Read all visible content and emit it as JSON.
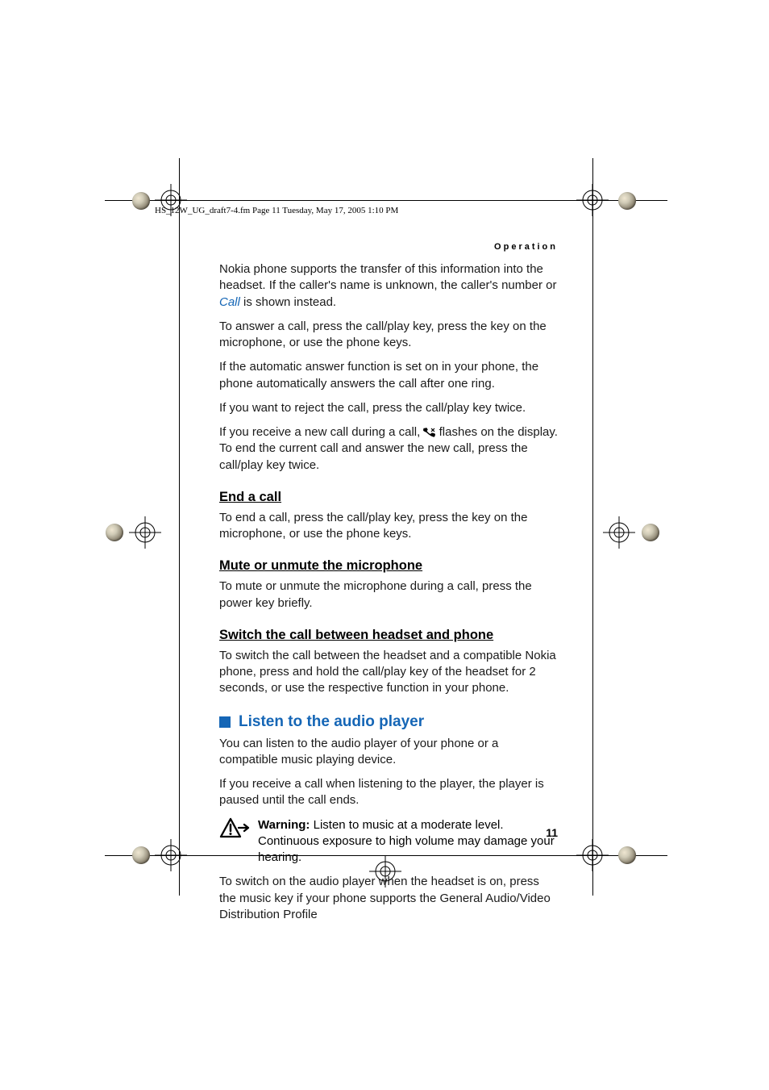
{
  "frame_header": "HS_12W_UG_draft7-4.fm  Page 11  Tuesday, May 17, 2005  1:10 PM",
  "running_head": "Operation",
  "page_number": "11",
  "p1a": "Nokia phone supports the transfer of this information into the headset. If the caller's name is unknown, the caller's number or ",
  "p1_link": "Call",
  "p1b": " is shown instead.",
  "p2": "To answer a call, press the call/play key, press the key on the microphone, or use the phone keys.",
  "p3": "If the automatic answer function is set on in your phone, the phone automatically answers the call after one ring.",
  "p4": "If you want to reject the call, press the call/play key twice.",
  "p5a": "If you receive a new call during a call, ",
  "p5b": " flashes on the display. To end the current call and answer the new call, press the call/play key twice.",
  "h_end": "End a call",
  "p6": "To end a call, press the call/play key, press the key on the microphone, or use the phone keys.",
  "h_mute": "Mute or unmute the microphone",
  "p7": "To mute or unmute the microphone during a call, press the power key briefly.",
  "h_switch": "Switch the call between headset and phone",
  "p8": "To switch the call between the headset and a compatible Nokia phone, press and hold the call/play key of the headset for 2 seconds, or use the respective function in your phone.",
  "h_listen": "Listen to the audio player",
  "p9": "You can listen to the audio player of your phone or a compatible music playing device.",
  "p10": "If you receive a call when listening to the player, the player is paused until the call ends.",
  "warn_label": "Warning:",
  "warn_text": " Listen to music at a moderate level. Continuous exposure to high volume may damage your hearing.",
  "p11": "To switch on the audio player when the headset is on, press the music key if your phone supports the General Audio/Video Distribution Profile"
}
